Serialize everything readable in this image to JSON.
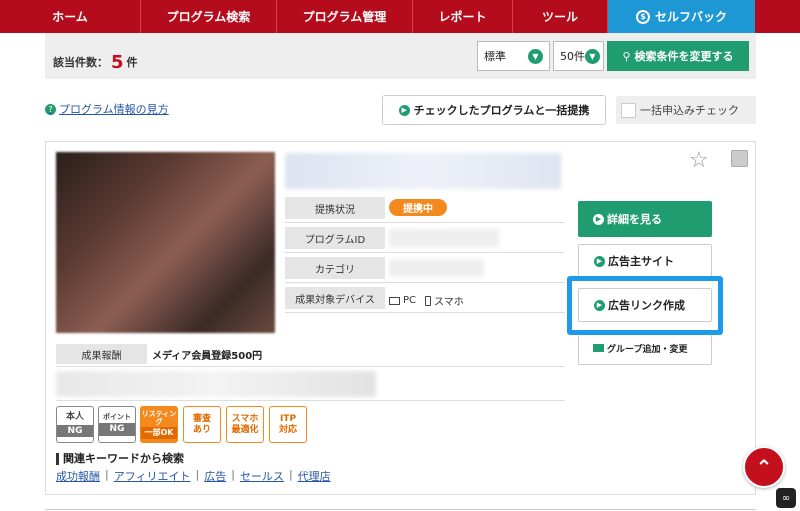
{
  "nav": {
    "items": [
      "ホーム",
      "プログラム検索",
      "プログラム管理",
      "レポート",
      "ツール"
    ],
    "selfback": "セルフバック",
    "selfback_icon": "selfback-coin-icon"
  },
  "countbar": {
    "label": "該当件数：",
    "count": "5",
    "unit": "件",
    "sort_select": "標準",
    "perpage_select": "50件",
    "search_button": "検索条件を変更する"
  },
  "info": {
    "help_link": "プログラム情報の見方",
    "bulk_button": "チェックしたプログラムと一括提携",
    "bulk_check": "一括申込みチェック"
  },
  "program": {
    "labels": {
      "status": "提携状況",
      "program_id": "プログラムID",
      "category": "カテゴリ",
      "device": "成果対象デバイス",
      "reward": "成果報酬"
    },
    "status_badge": "提携中",
    "device_pc": "PC",
    "device_sp": "スマホ",
    "reward_value": "メディア会員登録500円",
    "tags": [
      {
        "top": "本人",
        "bottom": "NG"
      },
      {
        "top": "ポイント",
        "bottom": "NG"
      },
      {
        "top": "リスティング",
        "bottom": "一部OK"
      },
      {
        "top": "審査",
        "bottom": "あり"
      },
      {
        "top": "スマホ",
        "bottom": "最適化"
      },
      {
        "top": "ITP",
        "bottom": "対応"
      }
    ],
    "keyword_title": "関連キーワードから検索",
    "keywords": [
      "成功報酬",
      "アフィリエイト",
      "広告",
      "セールス",
      "代理店"
    ],
    "separator": "|"
  },
  "actions": {
    "details": "詳細を見る",
    "advertiser_site": "広告主サイト",
    "create_link": "広告リンク作成",
    "group_add": "グループ追加・変更"
  },
  "colors": {
    "nav_red": "#b40c1c",
    "selfback_blue": "#1e98d4",
    "green": "#1f9d70",
    "orange": "#f48a1e",
    "highlight_blue": "#1d9be8"
  }
}
